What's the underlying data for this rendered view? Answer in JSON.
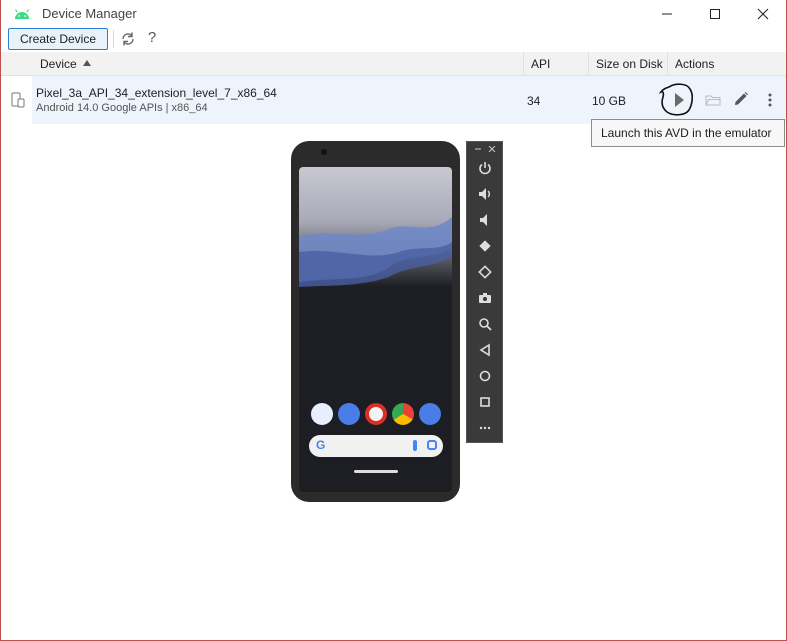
{
  "window": {
    "title": "Device Manager",
    "buttons": {
      "minimize": "minimize-icon",
      "maximize": "maximize-icon",
      "close": "close-icon"
    }
  },
  "toolbar": {
    "create_label": "Create Device",
    "refresh_icon": "refresh-icon",
    "help_label": "?"
  },
  "table": {
    "columns": [
      "Device",
      "API",
      "Size on Disk",
      "Actions"
    ],
    "sort": {
      "column": "Device",
      "direction": "ascending"
    },
    "rows": [
      {
        "name": "Pixel_3a_API_34_extension_level_7_x86_64",
        "subtitle": "Android 14.0 Google APIs | x86_64",
        "api": "34",
        "size": "10 GB",
        "actions": [
          "play-icon",
          "folder-icon",
          "edit-icon",
          "more-icon"
        ]
      }
    ]
  },
  "tooltip": {
    "text": "Launch this AVD in the emulator"
  },
  "colors": {
    "accent": "#2a7fd4",
    "row_selected": "#edf4fc",
    "header_bg": "#f2f2f2",
    "window_border": "#c0504d"
  }
}
